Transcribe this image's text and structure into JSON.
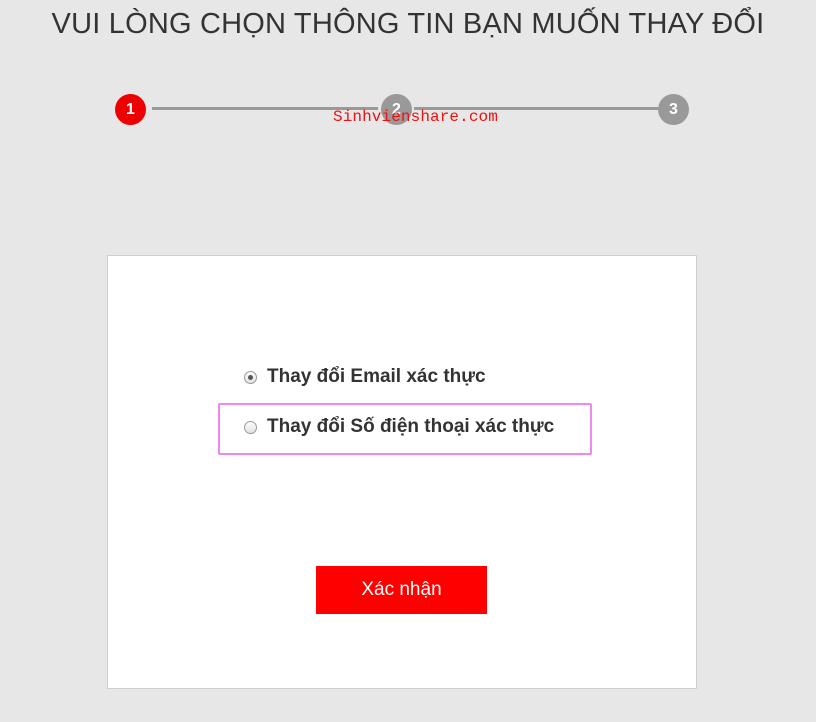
{
  "title": "VUI LÒNG CHỌN THÔNG TIN BẠN MUỐN THAY ĐỔI",
  "stepper": {
    "current_step": 1,
    "steps": [
      "1",
      "2",
      "3"
    ],
    "active_color": "#ee0000",
    "inactive_color": "#999999"
  },
  "watermark": "Sinhvienshare.com",
  "form": {
    "options": [
      {
        "label": "Thay đổi Email xác thực",
        "checked": true
      },
      {
        "label": "Thay đổi Số điện thoại xác thực",
        "checked": false,
        "highlighted": true
      }
    ],
    "submit_label": "Xác nhận",
    "submit_color": "#ff0000",
    "highlight_color": "#f088f0"
  }
}
